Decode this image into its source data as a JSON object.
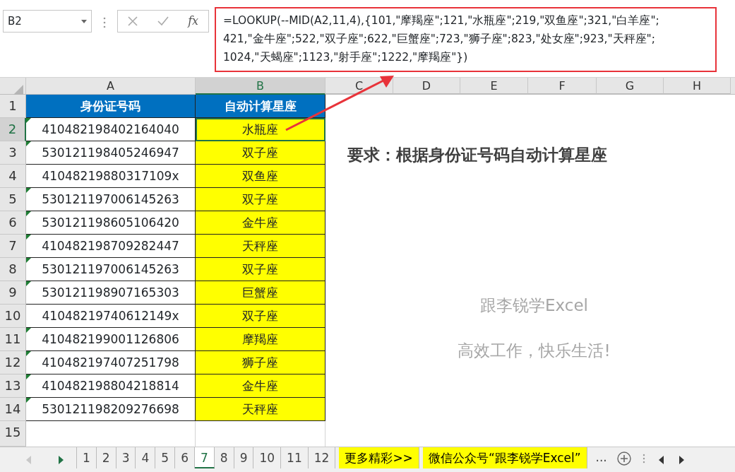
{
  "formula_bar": {
    "name_box": "B2",
    "fx": "fx",
    "formula_lines": [
      "=LOOKUP(--MID(A2,11,4),{101,\"摩羯座\";121,\"水瓶座\";219,\"双鱼座\";321,\"白羊座\";",
      "421,\"金牛座\";522,\"双子座\";622,\"巨蟹座\";723,\"狮子座\";823,\"处女座\";923,\"天秤座\";",
      "1024,\"天蝎座\";1123,\"射手座\";1222,\"摩羯座\"})"
    ]
  },
  "columns": [
    {
      "label": "A",
      "selected": false
    },
    {
      "label": "B",
      "selected": true
    },
    {
      "label": "C",
      "selected": false
    },
    {
      "label": "D",
      "selected": false
    },
    {
      "label": "E",
      "selected": false
    },
    {
      "label": "F",
      "selected": false
    },
    {
      "label": "G",
      "selected": false
    },
    {
      "label": "H",
      "selected": false
    }
  ],
  "rows": [
    {
      "number": "1",
      "selected": false,
      "kind": "header",
      "cells": [
        "身份证号码",
        "自动计算星座"
      ]
    },
    {
      "number": "2",
      "selected": true,
      "kind": "data",
      "error_flag": true,
      "cells": [
        "410482198402164040",
        "水瓶座"
      ]
    },
    {
      "number": "3",
      "selected": false,
      "kind": "data",
      "error_flag": true,
      "cells": [
        "530121198405246947",
        "双子座"
      ]
    },
    {
      "number": "4",
      "selected": false,
      "kind": "data",
      "error_flag": false,
      "cells": [
        "41048219880317109x",
        "双鱼座"
      ]
    },
    {
      "number": "5",
      "selected": false,
      "kind": "data",
      "error_flag": true,
      "cells": [
        "530121197006145263",
        "双子座"
      ]
    },
    {
      "number": "6",
      "selected": false,
      "kind": "data",
      "error_flag": true,
      "cells": [
        "530121198605106420",
        "金牛座"
      ]
    },
    {
      "number": "7",
      "selected": false,
      "kind": "data",
      "error_flag": true,
      "cells": [
        "410482198709282447",
        "天秤座"
      ]
    },
    {
      "number": "8",
      "selected": false,
      "kind": "data",
      "error_flag": true,
      "cells": [
        "530121197006145263",
        "双子座"
      ]
    },
    {
      "number": "9",
      "selected": false,
      "kind": "data",
      "error_flag": true,
      "cells": [
        "530121198907165303",
        "巨蟹座"
      ]
    },
    {
      "number": "10",
      "selected": false,
      "kind": "data",
      "error_flag": false,
      "cells": [
        "41048219740612149x",
        "双子座"
      ]
    },
    {
      "number": "11",
      "selected": false,
      "kind": "data",
      "error_flag": true,
      "cells": [
        "410482199001126806",
        "摩羯座"
      ]
    },
    {
      "number": "12",
      "selected": false,
      "kind": "data",
      "error_flag": true,
      "cells": [
        "410482197407251798",
        "狮子座"
      ]
    },
    {
      "number": "13",
      "selected": false,
      "kind": "data",
      "error_flag": true,
      "cells": [
        "410482198804218814",
        "金牛座"
      ]
    },
    {
      "number": "14",
      "selected": false,
      "kind": "data",
      "error_flag": true,
      "cells": [
        "530121198209276698",
        "天秤座"
      ]
    },
    {
      "number": "15",
      "selected": false,
      "kind": "empty",
      "cells": []
    }
  ],
  "notes": {
    "requirement": "要求：根据身份证号码自动计算星座",
    "slogan_lines": [
      "跟李锐学Excel",
      "高效工作，快乐生活!"
    ]
  },
  "sheet_tabs": [
    {
      "label": "1",
      "selected": false,
      "kind": "plain"
    },
    {
      "label": "2",
      "selected": false,
      "kind": "plain"
    },
    {
      "label": "3",
      "selected": false,
      "kind": "plain"
    },
    {
      "label": "4",
      "selected": false,
      "kind": "plain"
    },
    {
      "label": "5",
      "selected": false,
      "kind": "plain"
    },
    {
      "label": "6",
      "selected": false,
      "kind": "plain"
    },
    {
      "label": "7",
      "selected": true,
      "kind": "plain"
    },
    {
      "label": "8",
      "selected": false,
      "kind": "plain"
    },
    {
      "label": "9",
      "selected": false,
      "kind": "plain"
    },
    {
      "label": "10",
      "selected": false,
      "kind": "plain"
    },
    {
      "label": "11",
      "selected": false,
      "kind": "plain"
    },
    {
      "label": "12",
      "selected": false,
      "kind": "plain"
    },
    {
      "label": "更多精彩>>",
      "selected": false,
      "kind": "highlight",
      "color": "#ffff00"
    },
    {
      "label": "微信公众号“跟李锐学Excel”",
      "selected": false,
      "kind": "highlight",
      "color": "#ffff00"
    }
  ],
  "more_tabs": "..."
}
